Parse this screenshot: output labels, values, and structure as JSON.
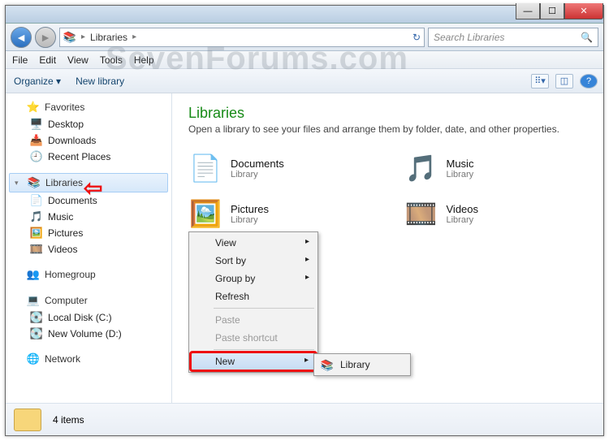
{
  "title_buttons": {
    "min": "—",
    "max": "☐",
    "close": "✕"
  },
  "address": {
    "icon": "📚",
    "path": "Libraries",
    "arrow": "▸"
  },
  "search": {
    "placeholder": "Search Libraries"
  },
  "menubar": [
    "File",
    "Edit",
    "View",
    "Tools",
    "Help"
  ],
  "toolbar": {
    "organize": "Organize ▾",
    "newlib": "New library"
  },
  "sidebar": {
    "favorites": {
      "label": "Favorites",
      "items": [
        "Desktop",
        "Downloads",
        "Recent Places"
      ]
    },
    "libraries": {
      "label": "Libraries",
      "items": [
        "Documents",
        "Music",
        "Pictures",
        "Videos"
      ]
    },
    "homegroup": {
      "label": "Homegroup"
    },
    "computer": {
      "label": "Computer",
      "items": [
        "Local Disk (C:)",
        "New Volume (D:)"
      ]
    },
    "network": {
      "label": "Network"
    }
  },
  "main": {
    "title": "Libraries",
    "subtitle": "Open a library to see your files and arrange them by folder, date, and other properties.",
    "items": [
      {
        "name": "Documents",
        "type": "Library",
        "icon": "📄"
      },
      {
        "name": "Music",
        "type": "Library",
        "icon": "🎵"
      },
      {
        "name": "Pictures",
        "type": "Library",
        "icon": "🖼️"
      },
      {
        "name": "Videos",
        "type": "Library",
        "icon": "🎞️"
      }
    ]
  },
  "context": {
    "items": [
      {
        "label": "View",
        "sub": true
      },
      {
        "label": "Sort by",
        "sub": true
      },
      {
        "label": "Group by",
        "sub": true
      },
      {
        "label": "Refresh"
      },
      {
        "sep": true
      },
      {
        "label": "Paste",
        "disabled": true
      },
      {
        "label": "Paste shortcut",
        "disabled": true
      },
      {
        "sep": true
      },
      {
        "label": "New",
        "sub": true,
        "selected": true,
        "highlight": true
      }
    ],
    "submenu": {
      "icon": "📚",
      "label": "Library"
    }
  },
  "status": {
    "count": "4 items"
  },
  "watermark": "SevenForums.com"
}
